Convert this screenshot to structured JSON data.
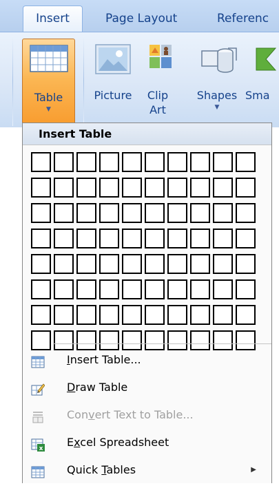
{
  "tabs": [
    {
      "label": "Insert",
      "active": true
    },
    {
      "label": "Page Layout",
      "active": false
    },
    {
      "label": "Referenc",
      "active": false
    }
  ],
  "ribbon": {
    "table_button": {
      "label": "Table",
      "icon": "table-icon",
      "pressed": true
    },
    "picture_button": {
      "label": "Picture",
      "icon": "picture-icon"
    },
    "clipart_button": {
      "label_line1": "Clip",
      "label_line2": "Art",
      "icon": "clip-art-icon"
    },
    "shapes_button": {
      "label": "Shapes",
      "icon": "shapes-icon"
    },
    "smartart_button": {
      "label": "Sma",
      "icon": "smartart-icon"
    }
  },
  "menu": {
    "header": "Insert Table",
    "grid": {
      "columns": 10,
      "rows": 8
    },
    "items": [
      {
        "pre": "",
        "key": "I",
        "post": "nsert Table...",
        "icon": "insert-table-icon",
        "disabled": false
      },
      {
        "pre": "",
        "key": "D",
        "post": "raw Table",
        "icon": "draw-table-icon",
        "disabled": false
      },
      {
        "pre": "Con",
        "key": "v",
        "post": "ert Text to Table...",
        "icon": "convert-text-icon",
        "disabled": true
      },
      {
        "pre": "E",
        "key": "x",
        "post": "cel Spreadsheet",
        "icon": "excel-spreadsheet-icon",
        "disabled": false
      },
      {
        "pre": "Quick ",
        "key": "T",
        "post": "ables",
        "icon": "quick-tables-icon",
        "disabled": false,
        "submenu": true
      }
    ]
  },
  "colors": {
    "tab_text": "#15428b",
    "active_button": "#fbb653",
    "ribbon_bg": "#dbe7f7",
    "disabled_text": "#a0a0a0"
  }
}
